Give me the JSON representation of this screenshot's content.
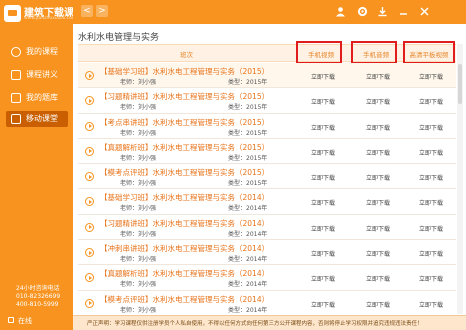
{
  "app": {
    "logo_title": "建筑下载课堂",
    "logo_url": "www.jianzhuxiazai.com"
  },
  "sidebar": {
    "items": [
      {
        "label": "我的课程",
        "icon": "play-circle-icon"
      },
      {
        "label": "课程讲义",
        "icon": "document-icon"
      },
      {
        "label": "我的题库",
        "icon": "book-icon"
      },
      {
        "label": "移动课堂",
        "icon": "mobile-icon",
        "active": true
      }
    ],
    "hotline_label": "24小时咨询电话",
    "hotline_1": "010-82326699",
    "hotline_2": "400-810-5999",
    "online_label": "在线"
  },
  "topbar": {
    "back": "<",
    "forward": ">",
    "icons": [
      "user-icon",
      "gear-icon",
      "download-icon",
      "minimize-icon",
      "close-icon"
    ]
  },
  "main": {
    "page_title": "水利水电管理与实务",
    "headers": {
      "course": "班次",
      "mobile": "手机视频",
      "audio": "手机音频",
      "hd": "高清平板视频"
    },
    "download_label": "立即下载",
    "rows": [
      {
        "title": "【基础学习班】水利水电工程管理与实务（2015）",
        "teacher": "老师：刘小强",
        "type": "类型：2015年"
      },
      {
        "title": "【习题精讲班】水利水电工程管理与实务（2015）",
        "teacher": "老师：刘小强",
        "type": "类型：2015年"
      },
      {
        "title": "【考点串讲班】水利水电工程管理与实务（2015）",
        "teacher": "老师：刘小强",
        "type": "类型：2015年"
      },
      {
        "title": "【真题解析班】水利水电工程管理与实务（2015）",
        "teacher": "老师：刘小强",
        "type": "类型：2015年"
      },
      {
        "title": "【模考点评班】水利水电工程管理与实务（2015）",
        "teacher": "老师：刘小强",
        "type": "类型：2015年"
      },
      {
        "title": "【基础学习班】水利水电工程管理与实务（2014）",
        "teacher": "老师：刘小强",
        "type": "类型：2014年"
      },
      {
        "title": "【习题精讲班】水利水电工程管理与实务（2014）",
        "teacher": "老师：刘小强",
        "type": "类型：2014年"
      },
      {
        "title": "【冲刺串讲班】水利水电工程管理与实务（2014）",
        "teacher": "老师：刘小强",
        "type": "类型：2014年"
      },
      {
        "title": "【真题解析班】水利水电工程管理与实务（2014）",
        "teacher": "老师：刘小强",
        "type": "类型：2014年"
      },
      {
        "title": "【模考点评班】水利水电工程管理与实务（2014）",
        "teacher": "老师：刘小强",
        "type": "类型：2014年"
      }
    ]
  },
  "footer": {
    "notice": "严正声明：学习课程仅供注册学员个人私自使用，不得以任何方式向任何第三方公开课程内容，否则将停止学习权限并追究违规违法责任！"
  },
  "colors": {
    "brand": "#f7931e",
    "highlight_border": "#e11c1c",
    "link": "#e8731a"
  }
}
